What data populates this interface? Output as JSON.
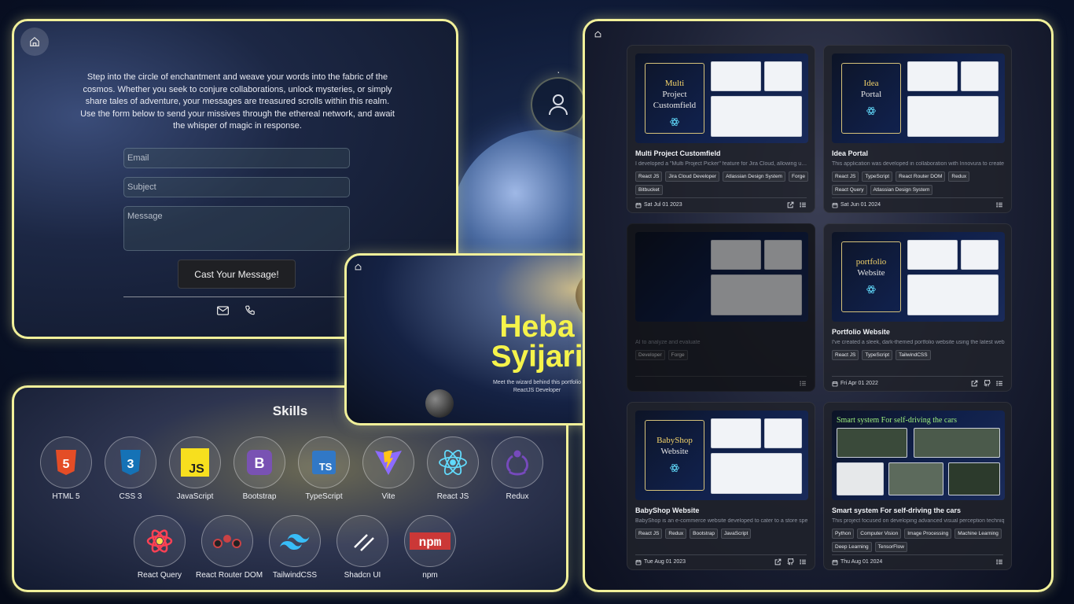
{
  "contact": {
    "intro": "Step into the circle of enchantment and weave your words into the fabric of the cosmos. Whether you seek to conjure collaborations, unlock mysteries, or simply share tales of adventure, your messages are treasured scrolls within this realm. Use the form below to send your missives through the ethereal network, and await the whisper of magic in response.",
    "email_placeholder": "Email",
    "subject_placeholder": "Subject",
    "message_placeholder": "Message",
    "send_label": "Cast Your Message!"
  },
  "skills": {
    "title": "Skills",
    "items": [
      {
        "label": "HTML 5",
        "icon": "html5-icon",
        "color": "#e44d26"
      },
      {
        "label": "CSS 3",
        "icon": "css3-icon",
        "color": "#1572b6"
      },
      {
        "label": "JavaScript",
        "icon": "javascript-icon",
        "color": "#f7df1e"
      },
      {
        "label": "Bootstrap",
        "icon": "bootstrap-icon",
        "color": "#7952b3"
      },
      {
        "label": "TypeScript",
        "icon": "typescript-icon",
        "color": "#3178c6"
      },
      {
        "label": "Vite",
        "icon": "vite-icon",
        "color": "#ffc517"
      },
      {
        "label": "React JS",
        "icon": "react-icon",
        "color": "#61dafb"
      },
      {
        "label": "Redux",
        "icon": "redux-icon",
        "color": "#764abc"
      },
      {
        "label": "React Query",
        "icon": "react-query-icon",
        "color": "#ff4154"
      },
      {
        "label": "React Router DOM",
        "icon": "react-router-icon",
        "color": "#ca4245"
      },
      {
        "label": "TailwindCSS",
        "icon": "tailwind-icon",
        "color": "#38bdf8"
      },
      {
        "label": "Shadcn UI",
        "icon": "shadcn-icon",
        "color": "#ffffff"
      },
      {
        "label": "npm",
        "icon": "npm-icon",
        "color": "#cb3837"
      }
    ]
  },
  "hero": {
    "first_name": "Heba",
    "last_name": "Syijari",
    "tagline": "Meet the wizard behind this portfolio",
    "role": "ReactJS Developer"
  },
  "projects": [
    {
      "title": "Multi Project Customfield",
      "thumb_words": [
        "Multi",
        "Project",
        "Customfield"
      ],
      "thumb_highlight": 0,
      "desc": "I developed a \"Multi Project Picker\" feature for Jira Cloud, allowing user",
      "tags": [
        "React JS",
        "Jira Cloud Developer",
        "Atlassian Design System",
        "Forge",
        "Bitbucket"
      ],
      "date": "Sat Jul 01 2023",
      "links": [
        "external-link-icon",
        "details-list-icon"
      ]
    },
    {
      "title": "Idea Portal",
      "thumb_words": [
        "Idea",
        "Portal"
      ],
      "thumb_highlight": 0,
      "desc": "This application was developed in collaboration with Innovura to create",
      "tags": [
        "React JS",
        "TypeScript",
        "React Router DOM",
        "Redux",
        "React Query",
        "Atlassian Design System"
      ],
      "date": "Sat Jun 01 2024",
      "links": [
        "details-list-icon"
      ]
    },
    {
      "title": "",
      "thumb_words": [],
      "thumb_highlight": -1,
      "desc": "AI to analyze and evaluate",
      "tags": [
        "Developer",
        "Forge"
      ],
      "date": "",
      "links": [
        "details-list-icon"
      ]
    },
    {
      "title": "Portfolio Website",
      "thumb_words": [
        "portfolio",
        "Website"
      ],
      "thumb_highlight": 0,
      "desc": "I've created a sleek, dark-themed portfolio website using the latest web",
      "tags": [
        "React JS",
        "TypeScript",
        "TailwindCSS"
      ],
      "date": "Fri Apr 01 2022",
      "links": [
        "external-link-icon",
        "github-icon",
        "details-list-icon"
      ]
    },
    {
      "title": "BabyShop Website",
      "thumb_words": [
        "BabyShop",
        "Website"
      ],
      "thumb_highlight": 0,
      "desc": "BabyShop is an e-commerce website developed to cater to a store spe",
      "tags": [
        "React JS",
        "Redux",
        "Bootstrap",
        "JavaScript"
      ],
      "date": "Tue Aug 01 2023",
      "links": [
        "external-link-icon",
        "github-icon",
        "details-list-icon"
      ]
    },
    {
      "title": "Smart system For self-driving the cars",
      "thumb_words": [
        "Smart system For self-driving the cars"
      ],
      "thumb_highlight": -1,
      "desc": "This project focused on developing advanced visual perception techniq",
      "tags": [
        "Python",
        "Computer Vision",
        "Image Processing",
        "Machine Learning",
        "Deep Learning",
        "TensorFlow"
      ],
      "date": "Thu Aug 01 2024",
      "links": [
        "details-list-icon"
      ]
    }
  ]
}
